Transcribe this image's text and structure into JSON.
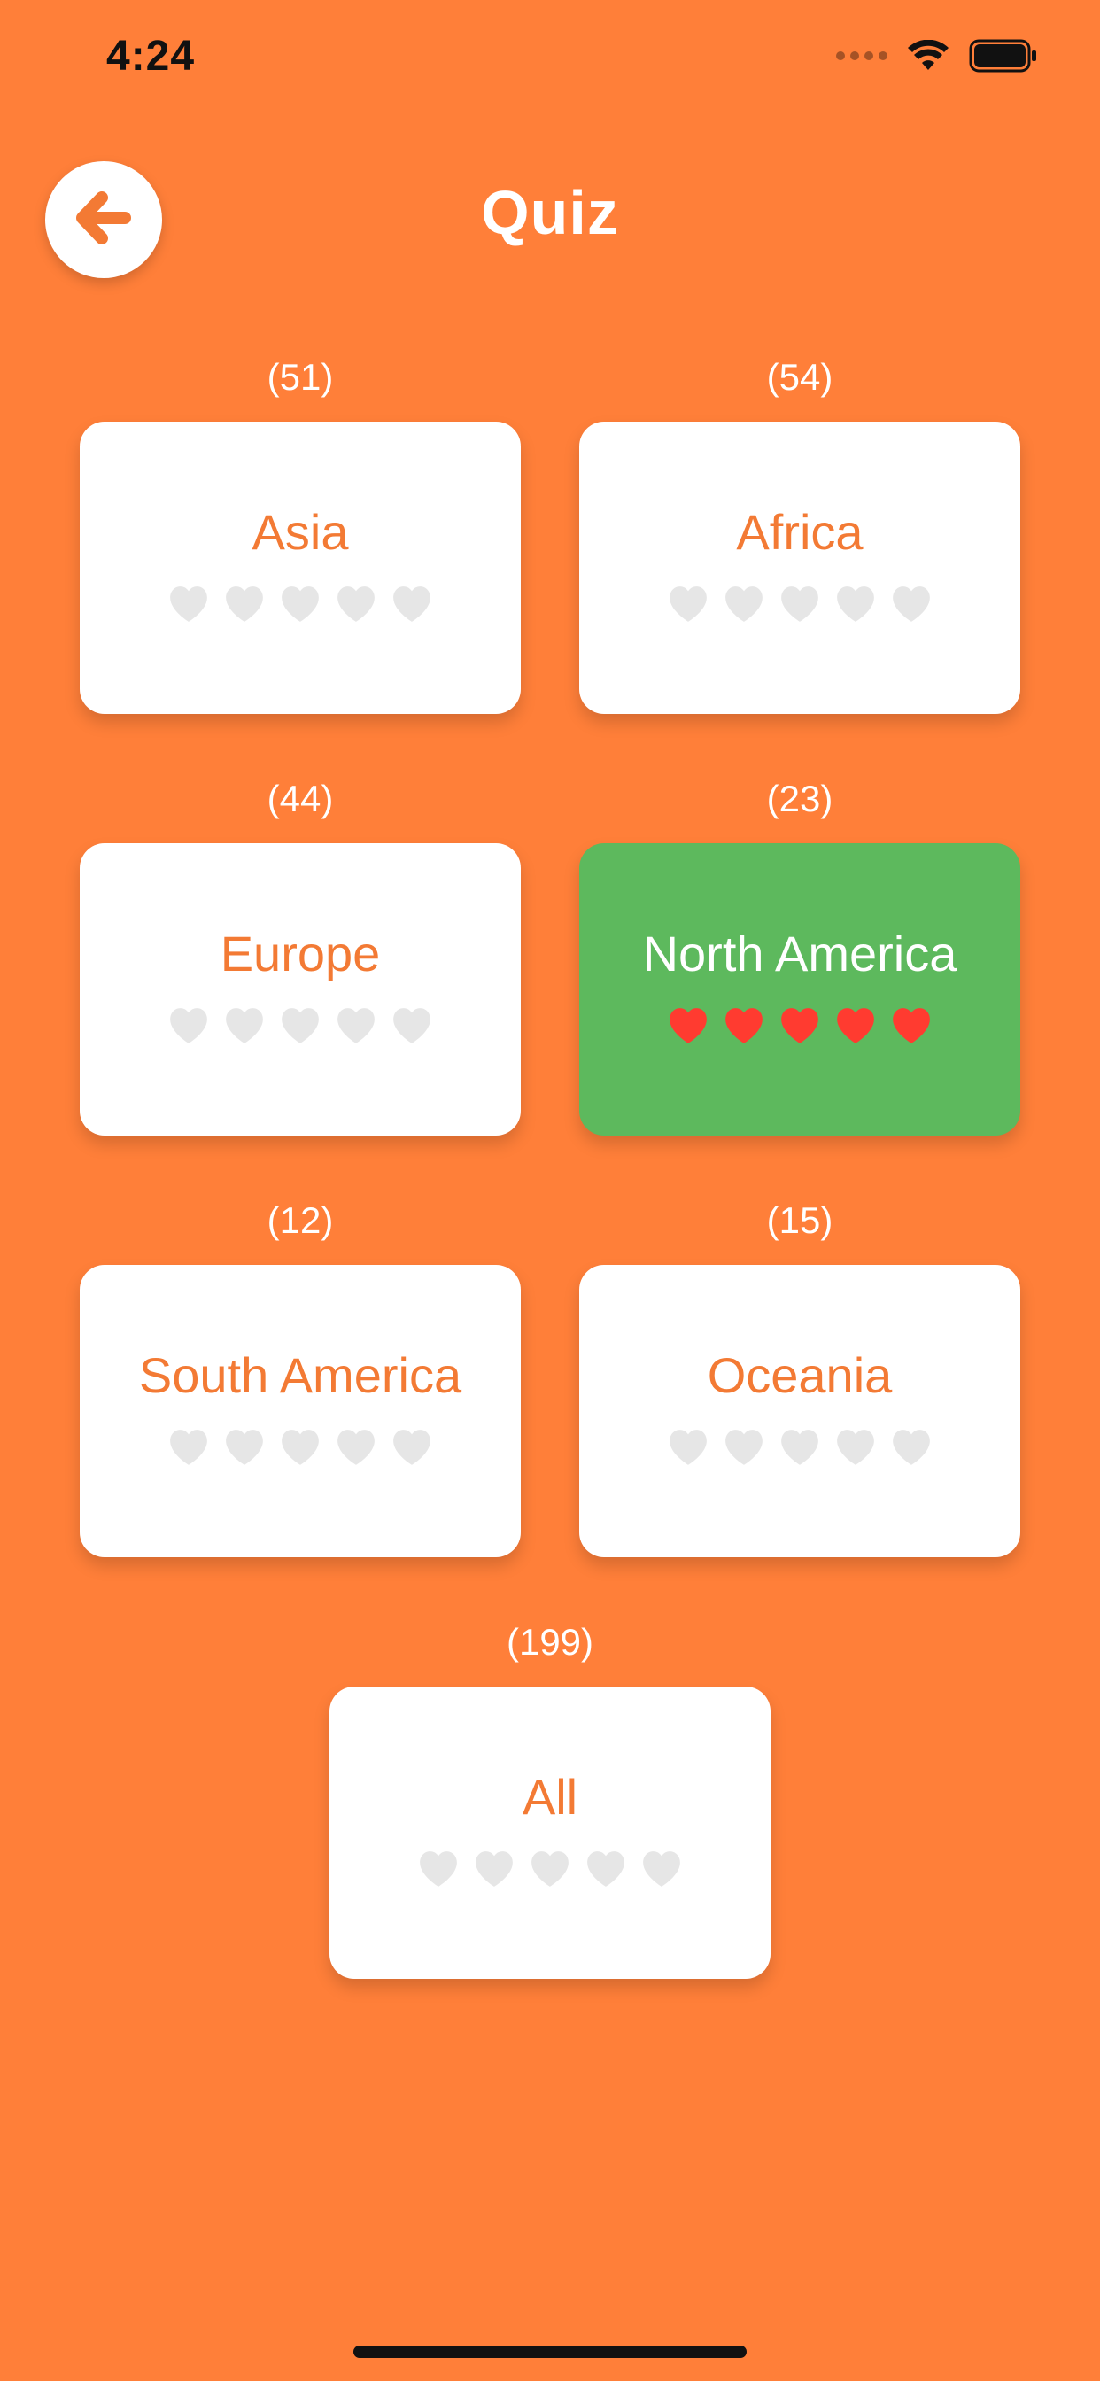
{
  "status_bar": {
    "time": "4:24"
  },
  "header": {
    "title": "Quiz",
    "back_icon": "arrow-left-icon"
  },
  "colors": {
    "background": "#FF7F39",
    "card": "#FFFFFF",
    "card_completed": "#5DB95D",
    "label": "#F37A34",
    "heart_empty": "#E6E6E6",
    "heart_filled": "#FF3B30"
  },
  "categories": [
    {
      "name": "Asia",
      "count": "(51)",
      "hearts_filled": 0,
      "completed": false
    },
    {
      "name": "Africa",
      "count": "(54)",
      "hearts_filled": 0,
      "completed": false
    },
    {
      "name": "Europe",
      "count": "(44)",
      "hearts_filled": 0,
      "completed": false
    },
    {
      "name": "North America",
      "count": "(23)",
      "hearts_filled": 5,
      "completed": true
    },
    {
      "name": "South America",
      "count": "(12)",
      "hearts_filled": 0,
      "completed": false
    },
    {
      "name": "Oceania",
      "count": "(15)",
      "hearts_filled": 0,
      "completed": false
    },
    {
      "name": "All",
      "count": "(199)",
      "hearts_filled": 0,
      "completed": false
    }
  ]
}
